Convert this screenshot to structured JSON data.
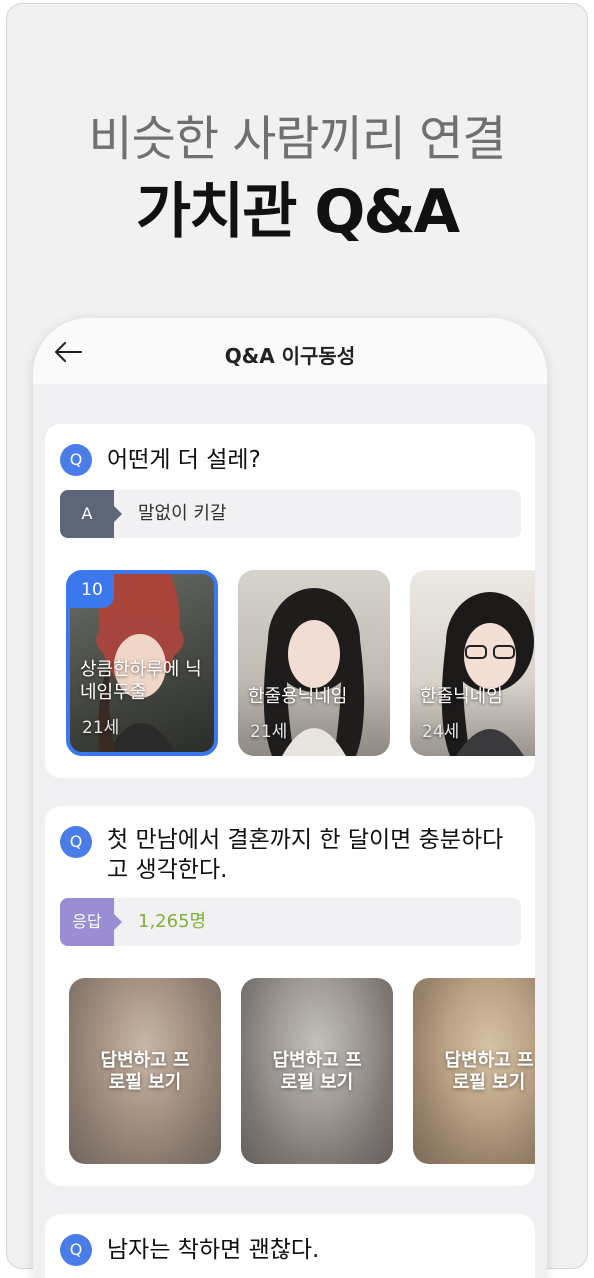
{
  "headline": {
    "subtitle": "비슷한 사람끼리 연결",
    "title": "가치관 Q&A"
  },
  "topbar": {
    "title": "Q&A 이구동성",
    "back_icon": "arrow-left-icon"
  },
  "questions": [
    {
      "badge": "Q",
      "text": "어떤게 더 설레?",
      "answer_tag": "A",
      "answer_text": "말없이 키갈",
      "tag_color": "#5c6677",
      "profiles": [
        {
          "count": "10",
          "name": "상큼한하루에 닉네임두줄",
          "age": "21세",
          "selected": true
        },
        {
          "name": "한줄용닉네임",
          "age": "21세"
        },
        {
          "name": "한줄닉네임",
          "age": "24세"
        }
      ]
    },
    {
      "badge": "Q",
      "text": "첫 만남에서 결혼까지 한 달이면 충분하다고 생각한다.",
      "answer_tag": "응답",
      "answer_text": "1,265명",
      "tag_color": "#9b8dd3",
      "answer_color": "#7fb23a",
      "profiles": [
        {
          "label": "답변하고 프로필 보기"
        },
        {
          "label": "답변하고 프로필 보기"
        },
        {
          "label": "답변하고 프로필 보기"
        }
      ]
    },
    {
      "badge": "Q",
      "text": "남자는 착하면 괜찮다."
    }
  ]
}
